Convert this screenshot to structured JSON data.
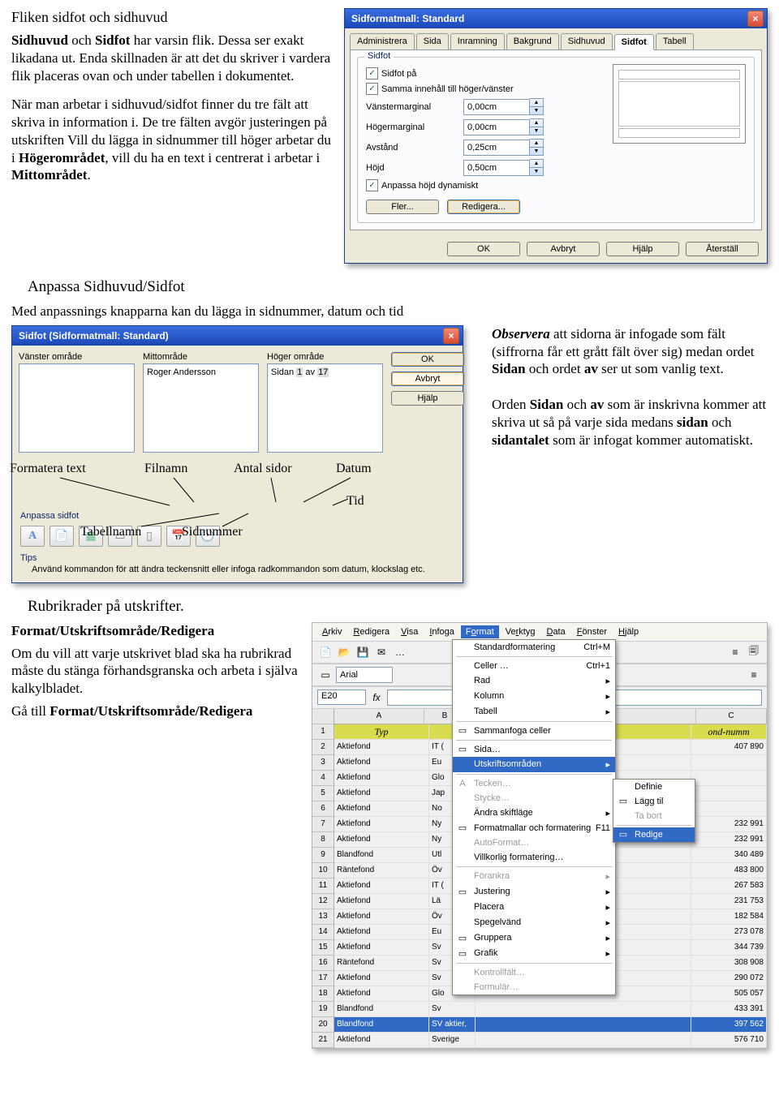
{
  "doc": {
    "section1_title": "Fliken sidfot och sidhuvud",
    "p1a": "Sidhuvud",
    "p1b": " och ",
    "p1c": "Sidfot",
    "p1d": " har varsin flik. Dessa ser exakt likadana ut. Enda skillnaden är att det du skriver i vardera flik placeras ovan och under tabellen i dokumentet.",
    "p2": "När man arbetar i sidhuvud/sidfot finner du tre fält att skriva in information i. De tre fälten avgör justeringen på utskriften Vill du lägga in sidnummer till höger arbetar du i ",
    "p2b": "Högerområdet",
    "p2c": ", vill du ha en text i centrerat i arbetar i ",
    "p2d": "Mittområdet",
    "p2e": ".",
    "section2_title": "Anpassa Sidhuvud/Sidfot",
    "p3": "Med anpassnings knapparna kan du lägga in sidnummer, datum och tid",
    "obs_a": "Observera",
    "obs_b": " att sidorna är infogade som fält (siffrorna får ett grått fält över sig) medan ordet ",
    "obs_c": "Sidan",
    "obs_d": " och ordet ",
    "obs_e": "av",
    "obs_f": " ser ut som vanlig text.",
    "p4a": "Orden ",
    "p4b": "Sidan",
    "p4c": " och ",
    "p4d": "av",
    "p4e": " som är inskrivna kommer att skriva ut så på varje sida medans ",
    "p4f": "sidan",
    "p4g": " och ",
    "p4h": "sidantalet",
    "p4i": " som är infogat kommer automatiskt.",
    "section3_title": "Rubrikrader på utskrifter.",
    "p5a": "Format/Utskriftsområde/Redigera",
    "p5b": "Om du vill att varje utskrivet blad ska ha rubrikrad måste du stänga förhandsgranska och arbeta i själva kalkylbladet.",
    "p5c": "Gå till ",
    "p5d": "Format/Utskriftsområde/Redigera",
    "callouts": {
      "formatera": "Formatera text",
      "filnamn": "Filnamn",
      "antal": "Antal sidor",
      "datum": "Datum",
      "tid": "Tid",
      "tabell": "Tabellnamn",
      "sidnr": "Sidnummer"
    }
  },
  "dlg1": {
    "title": "Sidformatmall: Standard",
    "tabs": [
      "Administrera",
      "Sida",
      "Inramning",
      "Bakgrund",
      "Sidhuvud",
      "Sidfot",
      "Tabell"
    ],
    "active_tab": "Sidfot",
    "legend": "Sidfot",
    "chk_on": "Sidfot på",
    "chk_same": "Samma innehåll till höger/vänster",
    "f_left": "Vänstermarginal",
    "f_right": "Högermarginal",
    "f_dist": "Avstånd",
    "f_height": "Höjd",
    "v_left": "0,00cm",
    "v_right": "0,00cm",
    "v_dist": "0,25cm",
    "v_height": "0,50cm",
    "chk_dyn": "Anpassa höjd dynamiskt",
    "btn_more": "Fler...",
    "btn_edit": "Redigera...",
    "btn_ok": "OK",
    "btn_cancel": "Avbryt",
    "btn_help": "Hjälp",
    "btn_reset": "Återställ"
  },
  "dlg2": {
    "title": "Sidfot (Sidformatmall: Standard)",
    "lbl_left": "Vänster område",
    "lbl_mid": "Mittområde",
    "lbl_right": "Höger område",
    "val_mid": "Roger Andersson",
    "val_right_a": "Sidan ",
    "val_right_page": "1",
    "val_right_b": " av ",
    "val_right_total": "17",
    "section_label": "Anpassa sidfot",
    "tips_label": "Tips",
    "tips_text": "Använd kommandon för att ändra teckensnitt eller infoga radkommandon som datum, klockslag etc.",
    "btn_ok": "OK",
    "btn_cancel": "Avbryt",
    "btn_help": "Hjälp"
  },
  "calc": {
    "menus": [
      "Arkiv",
      "Redigera",
      "Visa",
      "Infoga",
      "Format",
      "Verktyg",
      "Data",
      "Fönster",
      "Hjälp"
    ],
    "open": "Format",
    "font": "Arial",
    "namebox": "E20",
    "colA": "A",
    "colB": "B",
    "colC": "C",
    "header_typ": "Typ",
    "header_fond": "ond-numm",
    "rows": [
      {
        "n": "2",
        "a": "Aktiefond",
        "b": "IT (",
        "c": "407 890"
      },
      {
        "n": "3",
        "a": "Aktiefond",
        "b": "Eu",
        "c": ""
      },
      {
        "n": "4",
        "a": "Aktiefond",
        "b": "Glo",
        "c": ""
      },
      {
        "n": "5",
        "a": "Aktiefond",
        "b": "Jap",
        "c": ""
      },
      {
        "n": "6",
        "a": "Aktiefond",
        "b": "No",
        "c": ""
      },
      {
        "n": "7",
        "a": "Aktiefond",
        "b": "Ny",
        "c": "232 991"
      },
      {
        "n": "8",
        "a": "Aktiefond",
        "b": "Ny",
        "c": "232 991"
      },
      {
        "n": "9",
        "a": "Blandfond",
        "b": "Utl",
        "c": "340 489"
      },
      {
        "n": "10",
        "a": "Räntefond",
        "b": "Öv",
        "c": "483 800"
      },
      {
        "n": "11",
        "a": "Aktiefond",
        "b": "IT (",
        "c": "267 583"
      },
      {
        "n": "12",
        "a": "Aktiefond",
        "b": "Lä",
        "c": "231 753"
      },
      {
        "n": "13",
        "a": "Aktiefond",
        "b": "Öv",
        "c": "182 584"
      },
      {
        "n": "14",
        "a": "Aktiefond",
        "b": "Eu",
        "c": "273 078"
      },
      {
        "n": "15",
        "a": "Aktiefond",
        "b": "Sv",
        "c": "344 739"
      },
      {
        "n": "16",
        "a": "Räntefond",
        "b": "Sv",
        "c": "308 908"
      },
      {
        "n": "17",
        "a": "Aktiefond",
        "b": "Sv",
        "c": "290 072"
      },
      {
        "n": "18",
        "a": "Aktiefond",
        "b": "Glo",
        "c": "505 057"
      },
      {
        "n": "19",
        "a": "Blandfond",
        "b": "Sv",
        "c": "433 391"
      },
      {
        "n": "20",
        "a": "Blandfond",
        "b": "SV aktier, la aktier och sv rantor",
        "c": "397 562"
      },
      {
        "n": "21",
        "a": "Aktiefond",
        "b": "Sverige (normal)",
        "c": "576 710"
      }
    ],
    "menu_items": [
      {
        "t": "Standardformatering",
        "k": "Ctrl+M"
      },
      {
        "sep": true
      },
      {
        "t": "Celler …",
        "k": "Ctrl+1"
      },
      {
        "t": "Rad",
        "sub": true
      },
      {
        "t": "Kolumn",
        "sub": true
      },
      {
        "t": "Tabell",
        "sub": true
      },
      {
        "sep": true
      },
      {
        "t": "Sammanfoga celler",
        "ico": "▭"
      },
      {
        "sep": true
      },
      {
        "t": "Sida…",
        "ico": "▭"
      },
      {
        "t": "Utskriftsområden",
        "sub": true,
        "hl": true
      },
      {
        "sep": true
      },
      {
        "t": "Tecken…",
        "ico": "A",
        "dim": true
      },
      {
        "t": "Stycke…",
        "dim": true
      },
      {
        "t": "Ändra skiftläge",
        "sub": true
      },
      {
        "t": "Formatmallar och formatering",
        "k": "F11",
        "ico": "▭"
      },
      {
        "t": "AutoFormat…",
        "dim": true
      },
      {
        "t": "Villkorlig formatering…"
      },
      {
        "sep": true
      },
      {
        "t": "Förankra",
        "sub": true,
        "dim": true
      },
      {
        "t": "Justering",
        "sub": true,
        "ico": "▭"
      },
      {
        "t": "Placera",
        "sub": true
      },
      {
        "t": "Spegelvänd",
        "sub": true
      },
      {
        "t": "Gruppera",
        "sub": true,
        "ico": "▭"
      },
      {
        "t": "Grafik",
        "sub": true,
        "ico": "▭"
      },
      {
        "sep": true
      },
      {
        "t": "Kontrollfält…",
        "dim": true
      },
      {
        "t": "Formulär…",
        "dim": true
      }
    ],
    "submenu": [
      {
        "t": "Definie"
      },
      {
        "t": "Lägg til",
        "ico": "▭"
      },
      {
        "t": "Ta bort",
        "dim": true
      },
      {
        "sep": true
      },
      {
        "t": "Redige",
        "hl": true,
        "ico": "▭"
      }
    ]
  }
}
